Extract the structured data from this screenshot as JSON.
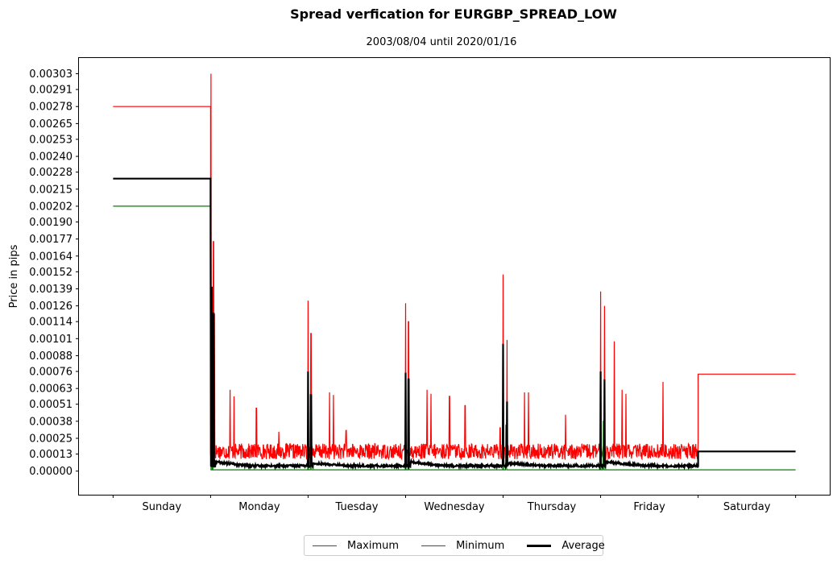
{
  "chart_data": {
    "type": "line",
    "title": "Spread verfication for EURGBP_SPREAD_LOW",
    "subtitle": "2003/08/04 until 2020/01/16",
    "xlabel": "",
    "ylabel": "Price in pips",
    "x_tick_labels": [
      "Sunday",
      "Monday",
      "Tuesday",
      "Wednesday",
      "Thursday",
      "Friday",
      "Saturday"
    ],
    "x_range_days": [
      -0.35,
      7.35
    ],
    "ylim": [
      -0.00018,
      0.00315
    ],
    "y_ticks": [
      "0.00303",
      "0.00291",
      "0.00278",
      "0.00265",
      "0.00253",
      "0.00240",
      "0.00228",
      "0.00215",
      "0.00202",
      "0.00190",
      "0.00177",
      "0.00164",
      "0.00152",
      "0.00139",
      "0.00126",
      "0.00114",
      "0.00101",
      "0.00088",
      "0.00076",
      "0.00063",
      "0.00051",
      "0.00038",
      "0.00025",
      "0.00013",
      "0.00000"
    ],
    "grid": false,
    "legend": {
      "placement": "bottom-center",
      "entries": [
        {
          "name": "Maximum",
          "color": "#ff0000"
        },
        {
          "name": "Minimum",
          "color": "#008000"
        },
        {
          "name": "Average",
          "color": "#000000"
        }
      ]
    },
    "series": [
      {
        "name": "Maximum",
        "color": "#ff0000",
        "plateaus": [
          {
            "from": 0.0,
            "to": 1.0,
            "value": 0.00278
          },
          {
            "from": 6.0,
            "to": 7.0,
            "value": 0.00074
          }
        ],
        "baseline": 0.00015,
        "noise": 6e-05,
        "spikes": [
          {
            "x": 1.005,
            "value": 0.00303
          },
          {
            "x": 1.03,
            "value": 0.00175
          },
          {
            "x": 1.04,
            "value": 0.0012
          },
          {
            "x": 1.2,
            "value": 0.00062
          },
          {
            "x": 1.24,
            "value": 0.00057
          },
          {
            "x": 1.47,
            "value": 0.00048
          },
          {
            "x": 1.7,
            "value": 0.0003
          },
          {
            "x": 2.0,
            "value": 0.0013
          },
          {
            "x": 2.03,
            "value": 0.00105
          },
          {
            "x": 2.22,
            "value": 0.0006
          },
          {
            "x": 2.26,
            "value": 0.00058
          },
          {
            "x": 2.39,
            "value": 0.00031
          },
          {
            "x": 3.0,
            "value": 0.00128
          },
          {
            "x": 3.03,
            "value": 0.00114
          },
          {
            "x": 3.22,
            "value": 0.00062
          },
          {
            "x": 3.26,
            "value": 0.00059
          },
          {
            "x": 3.45,
            "value": 0.00057
          },
          {
            "x": 3.61,
            "value": 0.0005
          },
          {
            "x": 3.97,
            "value": 0.00033
          },
          {
            "x": 4.0,
            "value": 0.0015
          },
          {
            "x": 4.04,
            "value": 0.001
          },
          {
            "x": 4.22,
            "value": 0.0006
          },
          {
            "x": 4.26,
            "value": 0.0006
          },
          {
            "x": 4.64,
            "value": 0.00043
          },
          {
            "x": 5.0,
            "value": 0.00137
          },
          {
            "x": 5.04,
            "value": 0.00126
          },
          {
            "x": 5.14,
            "value": 0.00099
          },
          {
            "x": 5.22,
            "value": 0.00062
          },
          {
            "x": 5.26,
            "value": 0.00059
          },
          {
            "x": 5.64,
            "value": 0.00068
          }
        ]
      },
      {
        "name": "Minimum",
        "color": "#008000",
        "plateaus": [
          {
            "from": 0.0,
            "to": 1.0,
            "value": 0.00202
          },
          {
            "from": 6.0,
            "to": 7.0,
            "value": 1e-05
          }
        ],
        "baseline": 1e-05,
        "noise": 0.0,
        "spikes": [
          {
            "x": 1.0,
            "value": 0.00135
          },
          {
            "x": 1.02,
            "value": 0.0008
          },
          {
            "x": 2.0,
            "value": 0.0002
          },
          {
            "x": 2.03,
            "value": 0.0003
          },
          {
            "x": 3.0,
            "value": 0.0002
          },
          {
            "x": 3.03,
            "value": 0.0005
          },
          {
            "x": 4.0,
            "value": 0.0002
          },
          {
            "x": 4.03,
            "value": 0.00035
          },
          {
            "x": 5.0,
            "value": 0.0002
          },
          {
            "x": 5.03,
            "value": 0.00038
          }
        ]
      },
      {
        "name": "Average",
        "color": "#000000",
        "plateaus": [
          {
            "from": 0.0,
            "to": 1.0,
            "value": 0.00223
          },
          {
            "from": 6.0,
            "to": 7.0,
            "value": 0.00015
          }
        ],
        "baseline": 4e-05,
        "noise": 8e-06,
        "session_bumps": [
          {
            "from": 1.05,
            "to": 1.4,
            "value": 7e-05
          },
          {
            "from": 2.05,
            "to": 2.4,
            "value": 6e-05
          },
          {
            "from": 3.05,
            "to": 3.4,
            "value": 7e-05
          },
          {
            "from": 4.05,
            "to": 4.4,
            "value": 6e-05
          },
          {
            "from": 5.05,
            "to": 5.45,
            "value": 7e-05
          }
        ],
        "spikes": [
          {
            "x": 1.0,
            "value": 0.0018
          },
          {
            "x": 1.01,
            "value": 0.0014
          },
          {
            "x": 1.03,
            "value": 0.0012
          },
          {
            "x": 2.0,
            "value": 0.00076
          },
          {
            "x": 2.03,
            "value": 0.00058
          },
          {
            "x": 3.0,
            "value": 0.00075
          },
          {
            "x": 3.03,
            "value": 0.0007
          },
          {
            "x": 4.0,
            "value": 0.00097
          },
          {
            "x": 4.04,
            "value": 0.00053
          },
          {
            "x": 5.0,
            "value": 0.00076
          },
          {
            "x": 5.04,
            "value": 0.0007
          }
        ]
      }
    ]
  }
}
